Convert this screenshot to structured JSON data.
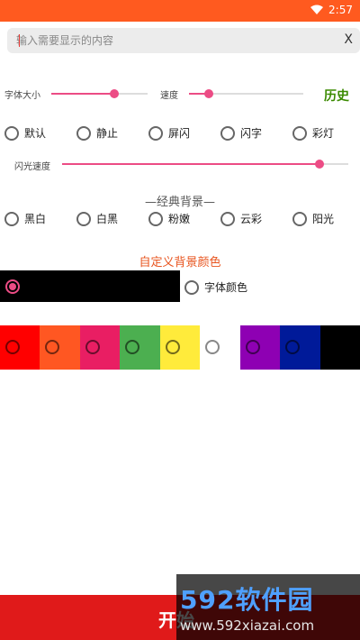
{
  "status_bar": {
    "time": "2:57"
  },
  "input": {
    "placeholder": "输入需要显示的内容",
    "clear_label": "X"
  },
  "controls": {
    "font_size_label": "字体大小",
    "font_size_value": 0.65,
    "speed_label": "速度",
    "speed_value": 0.17,
    "history_label": "历史",
    "flash_speed_label": "闪光速度",
    "flash_speed_value": 0.9
  },
  "modes": [
    {
      "label": "默认"
    },
    {
      "label": "静止"
    },
    {
      "label": "屏闪"
    },
    {
      "label": "闪字"
    },
    {
      "label": "彩灯"
    }
  ],
  "classic_title": "—经典背景—",
  "backgrounds": [
    {
      "label": "黑白"
    },
    {
      "label": "白黑"
    },
    {
      "label": "粉嫩"
    },
    {
      "label": "云彩"
    },
    {
      "label": "阳光"
    }
  ],
  "custom_title": "自定义背景颜色",
  "font_color_label": "字体颜色",
  "swatches": [
    "#ff0000",
    "#ff5722",
    "#e91e63",
    "#4caf50",
    "#ffeb3b",
    "#ffffff",
    "#8e00b3",
    "#001a99",
    "#000000"
  ],
  "start_label": "开始",
  "watermark": {
    "logo": "592软件园",
    "url": "www.592xiazai.com"
  }
}
